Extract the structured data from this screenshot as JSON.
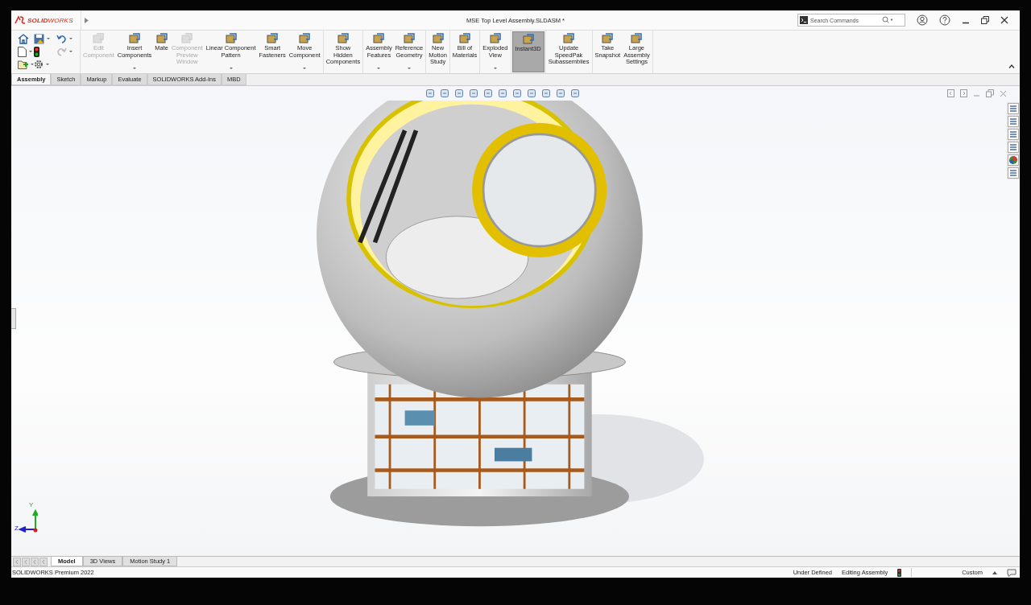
{
  "app": {
    "logo": "**SOLID**WORKS"
  },
  "window": {
    "title": "MSE Top Level Assembly.SLDASM *",
    "search": {
      "placeholder": "Search Commands"
    }
  },
  "ribbon": {
    "groups": [
      [
        {
          "label": "Edit\nComponent",
          "disabled": true,
          "dropdown": false,
          "selected": false
        },
        {
          "label": "Insert\nComponents",
          "disabled": false,
          "dropdown": true,
          "selected": false
        },
        {
          "label": "Mate",
          "disabled": false,
          "dropdown": false,
          "selected": false
        },
        {
          "label": "Component\nPreview\nWindow",
          "disabled": true,
          "dropdown": false,
          "selected": false
        },
        {
          "label": "Linear Component\nPattern",
          "disabled": false,
          "dropdown": true,
          "selected": false
        },
        {
          "label": "Smart\nFasteners",
          "disabled": false,
          "dropdown": false,
          "selected": false
        },
        {
          "label": "Move\nComponent",
          "disabled": false,
          "dropdown": true,
          "selected": false
        }
      ],
      [
        {
          "label": "Show\nHidden\nComponents",
          "disabled": false,
          "dropdown": false,
          "selected": false
        }
      ],
      [
        {
          "label": "Assembly\nFeatures",
          "disabled": false,
          "dropdown": true,
          "selected": false
        },
        {
          "label": "Reference\nGeometry",
          "disabled": false,
          "dropdown": true,
          "selected": false
        }
      ],
      [
        {
          "label": "New\nMotion\nStudy",
          "disabled": false,
          "dropdown": false,
          "selected": false
        }
      ],
      [
        {
          "label": "Bill of\nMaterials",
          "disabled": false,
          "dropdown": false,
          "selected": false
        }
      ],
      [
        {
          "label": "Exploded\nView",
          "disabled": false,
          "dropdown": true,
          "selected": false
        }
      ],
      [
        {
          "label": "Instant3D",
          "disabled": false,
          "dropdown": false,
          "selected": true
        }
      ],
      [
        {
          "label": "Update\nSpeedPak\nSubassemblies",
          "disabled": false,
          "dropdown": false,
          "selected": false
        }
      ],
      [
        {
          "label": "Take\nSnapshot",
          "disabled": false,
          "dropdown": false,
          "selected": false
        },
        {
          "label": "Large\nAssembly\nSettings",
          "disabled": false,
          "dropdown": false,
          "selected": false
        }
      ]
    ]
  },
  "tabs": [
    {
      "label": "Assembly",
      "selected": true
    },
    {
      "label": "Sketch",
      "selected": false
    },
    {
      "label": "Markup",
      "selected": false
    },
    {
      "label": "Evaluate",
      "selected": false
    },
    {
      "label": "SOLIDWORKS Add-Ins",
      "selected": false
    },
    {
      "label": "MBD",
      "selected": false
    }
  ],
  "viewport": {
    "triad": {
      "y": "Y",
      "z": "Z"
    }
  },
  "bottom_tabs": [
    {
      "label": "Model",
      "selected": true
    },
    {
      "label": "3D Views",
      "selected": false
    },
    {
      "label": "Motion Study 1",
      "selected": false
    }
  ],
  "status_bar": {
    "product": "SOLIDWORKS Premium 2022",
    "state": "Under Defined",
    "mode": "Editing Assembly",
    "units": "Custom"
  }
}
